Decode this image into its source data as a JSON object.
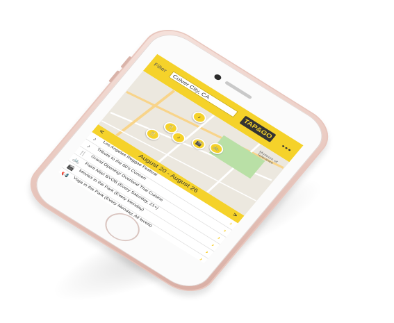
{
  "app": {
    "filter_label": "Filter",
    "location_value": "Culver City, CA",
    "logo_text": "TAP&GO",
    "more_label": "•••"
  },
  "map": {
    "labels": {
      "museum": "Museum of\nTolerance"
    },
    "pins": [
      {
        "icon": "music-note-icon",
        "glyph": "♪"
      },
      {
        "icon": "utensils-icon",
        "glyph": "🍴"
      },
      {
        "icon": "music-note-icon",
        "glyph": "♪"
      },
      {
        "icon": "utensils-icon",
        "glyph": "🍴"
      },
      {
        "icon": "bike-icon",
        "glyph": "🚲"
      },
      {
        "icon": "film-icon",
        "glyph": "🎬"
      }
    ]
  },
  "date_range": {
    "prev": "<",
    "label": "August 20 - August 26",
    "next": ">"
  },
  "events": [
    {
      "icon": "music-note-icon",
      "glyph": "♪",
      "title": "Los Angeles Reggae Festival",
      "subtitle": ""
    },
    {
      "icon": "music-note-icon",
      "glyph": "♪",
      "title": "Tribute to the 60's Concert",
      "subtitle": ""
    },
    {
      "icon": "utensils-icon",
      "glyph": "🍴",
      "title": "Grand Opening! Overland Thai Cuisine",
      "subtitle": ""
    },
    {
      "icon": "bike-icon",
      "glyph": "🚲",
      "title": "Paint Nite! BYOB (Every Saturday, 21+)",
      "subtitle": ""
    },
    {
      "icon": "film-icon",
      "glyph": "🎬",
      "title": "Movies in the Park (Every Monday)",
      "subtitle": ""
    },
    {
      "icon": "megaphone-icon",
      "glyph": "📢",
      "title": "Yoga in the Park (Every Monday, All levels)",
      "subtitle": ""
    }
  ],
  "colors": {
    "accent": "#f5d22a",
    "phone_body": "#e9c9c0"
  }
}
